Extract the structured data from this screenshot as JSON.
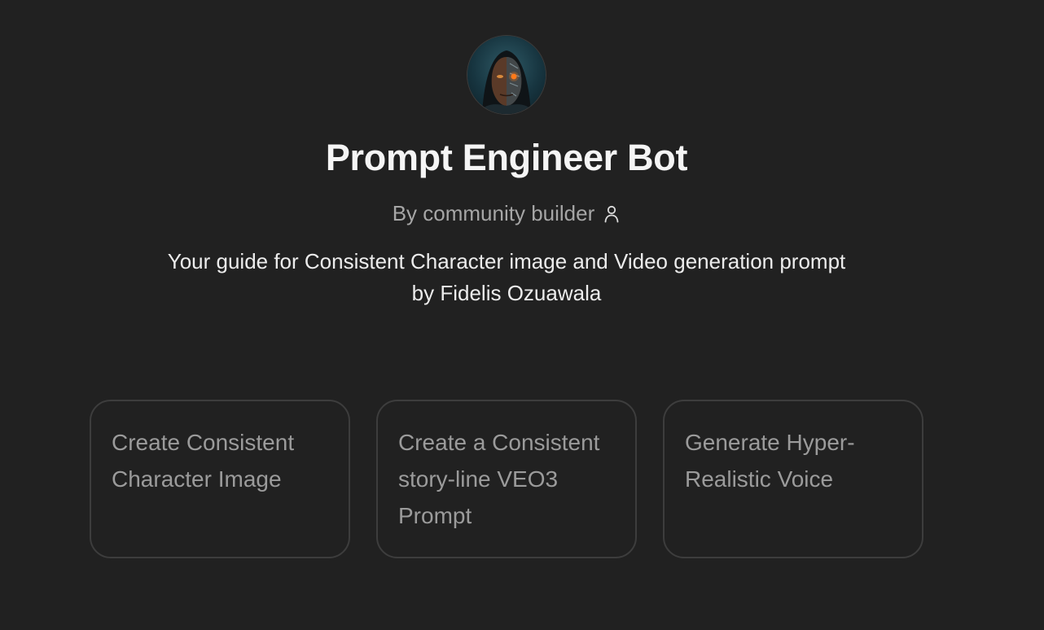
{
  "bot": {
    "name": "Prompt Engineer Bot",
    "byline": "By community builder",
    "description": "Your guide for Consistent Character image and Video generation prompt by Fidelis Ozuawala",
    "avatar_icon": "cyborg-portrait-avatar"
  },
  "starters": [
    {
      "label": "Create Consistent Character Image"
    },
    {
      "label": "Create a Consistent story-line VEO3 Prompt"
    },
    {
      "label": "Generate Hyper-Realistic Voice"
    }
  ],
  "colors": {
    "background": "#212121",
    "card_border": "#3d3d3d",
    "muted_text": "#9b9b9b",
    "byline_text": "#a6a6a6",
    "title_text": "#f5f5f5"
  }
}
